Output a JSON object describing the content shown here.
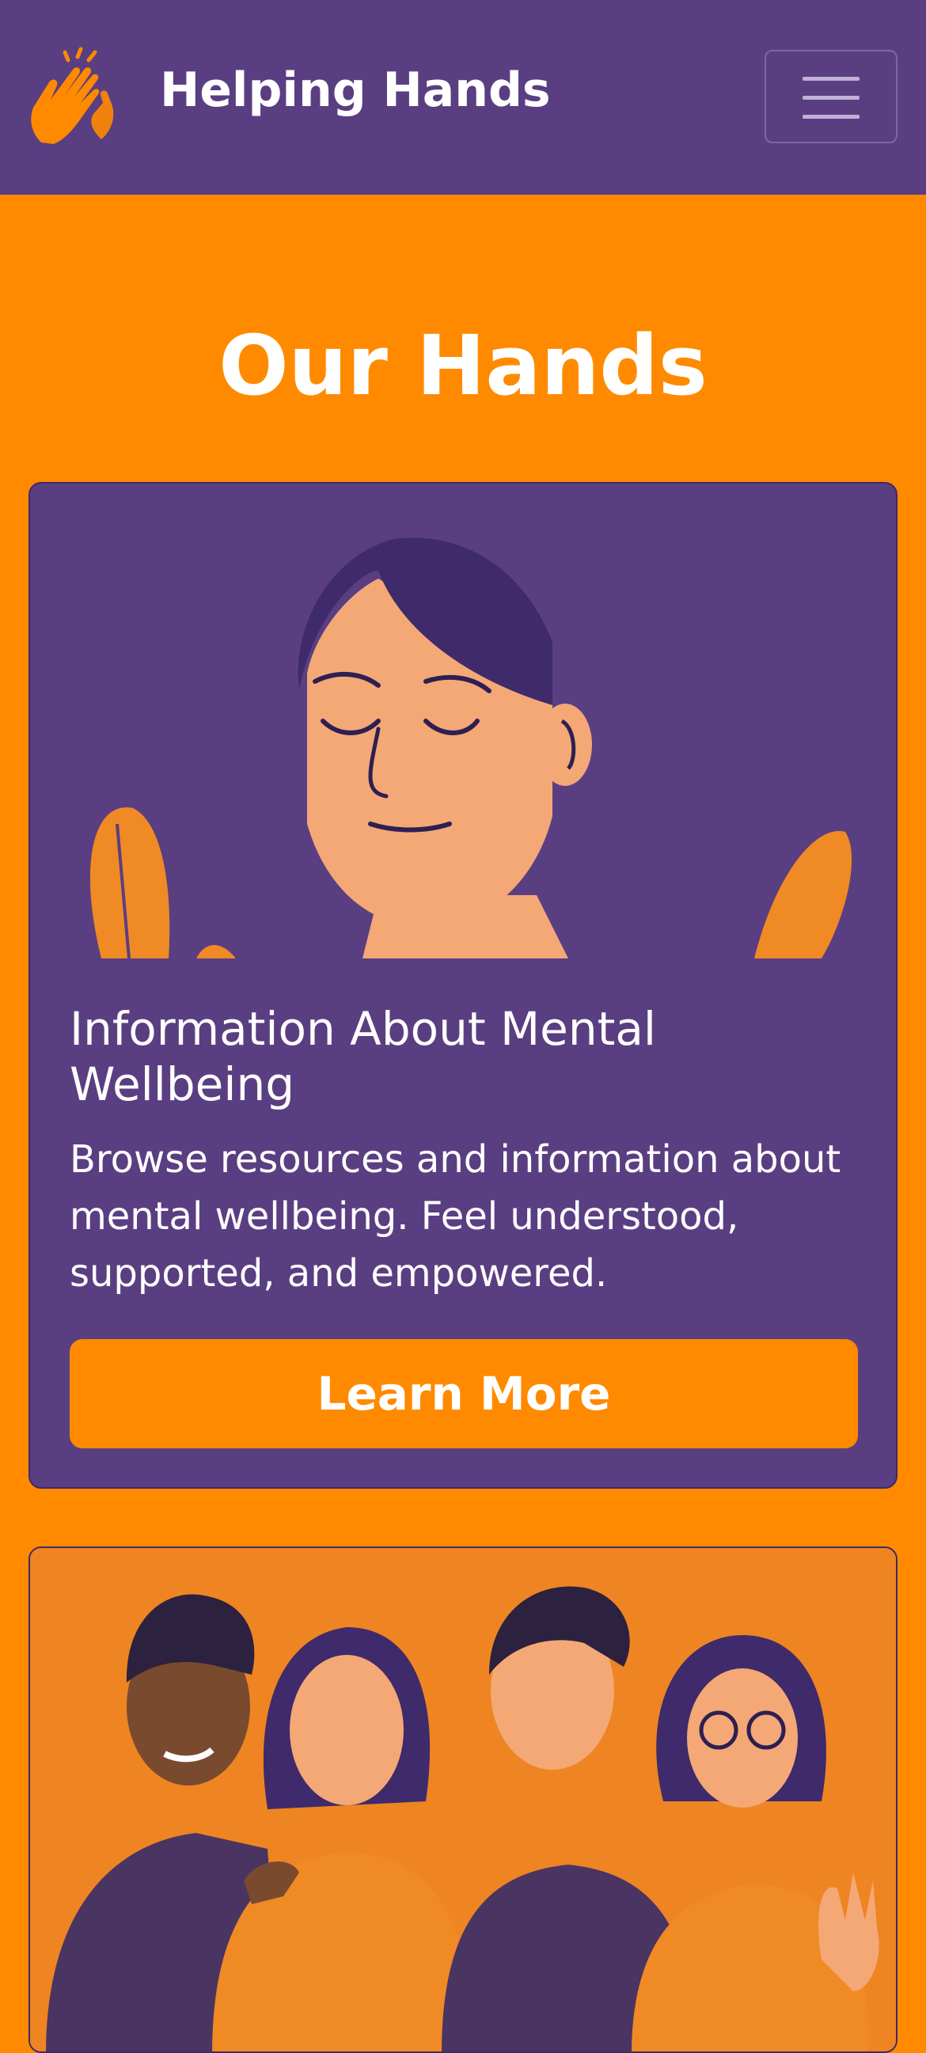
{
  "navbar": {
    "brand_name": "Helping Hands",
    "brand_icon": "high-five-hands-icon",
    "menu_icon": "hamburger-menu-icon"
  },
  "page_title": "Our Hands",
  "cards": [
    {
      "image": "illustration-calm-woman-eyes-closed",
      "title": "Information About Mental Wellbeing",
      "text": "Browse resources and information about mental wellbeing. Feel understood, supported, and empowered.",
      "button_label": "Learn More"
    },
    {
      "image": "illustration-group-of-four-friends"
    }
  ],
  "colors": {
    "navbar_bg": "#5A3E82",
    "page_bg": "#FF8A00",
    "card_bg": "#5A3E82",
    "button_bg": "#FF8A00",
    "text": "#FFFFFF"
  }
}
